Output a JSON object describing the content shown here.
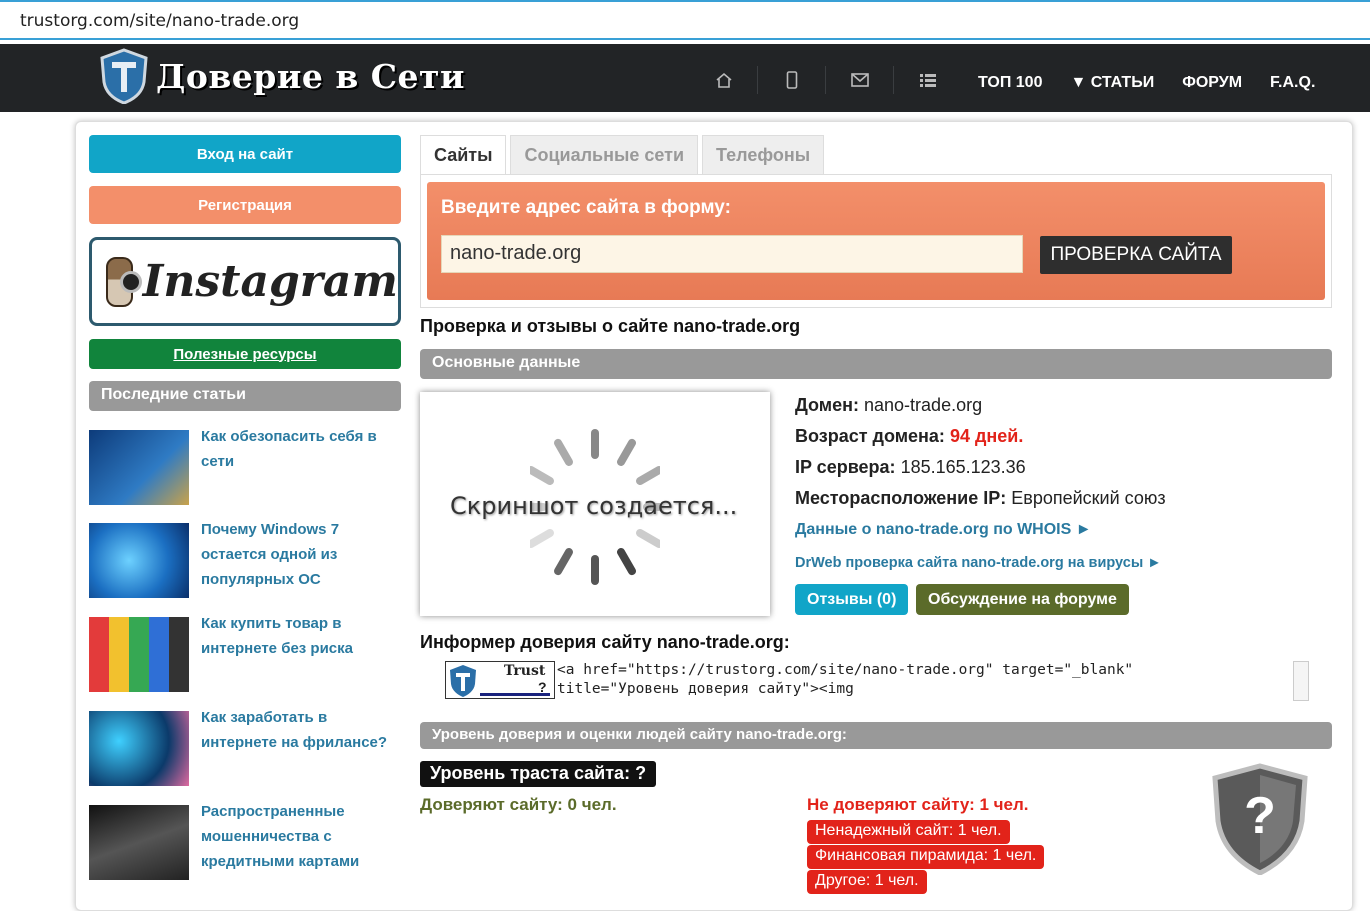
{
  "browser": {
    "url": "trustorg.com/site/nano-trade.org"
  },
  "site": {
    "logo_text": "Доверие в Сети"
  },
  "nav": {
    "icons": [
      "home-icon",
      "mobile-icon",
      "mail-icon",
      "list-icon"
    ],
    "links": [
      "ТОП 100",
      "▼ СТАТЬИ",
      "ФОРУМ",
      "F.A.Q."
    ]
  },
  "sidebar": {
    "login": "Вход на сайт",
    "register": "Регистрация",
    "instagram": "Instagram",
    "useful": "Полезные ресурсы",
    "recent_heading": "Последние статьи",
    "articles": [
      "Как обезопасить себя в сети",
      "Почему Windows 7 остается одной из популярных ОС",
      "Как купить товар в интернете без риска",
      "Как заработать в интернете на фрилансе?",
      "Распространенные мошенничества с кредитными картами"
    ]
  },
  "tabs": [
    "Сайты",
    "Социальные сети",
    "Телефоны"
  ],
  "form": {
    "prompt": "Введите адрес сайта в форму:",
    "value": "nano-trade.org",
    "button": "ПРОВЕРКА САЙТА"
  },
  "page_title": "Проверка и отзывы о сайте nano-trade.org",
  "basic": {
    "heading": "Основные данные",
    "screenshot_text": "Скриншот создается...",
    "domain_label": "Домен:",
    "domain_value": "nano-trade.org",
    "age_label": "Возраст домена:",
    "age_value": "94 дней.",
    "ip_label": "IP сервера:",
    "ip_value": "185.165.123.36",
    "loc_label": "Месторасположение IP:",
    "loc_value": "Европейский союз",
    "whois_link": "Данные о nano-trade.org по WHOIS ►",
    "drweb_link": "DrWeb проверка сайта nano-trade.org на вирусы ►",
    "reviews_button": "Отзывы (0)",
    "forum_button": "Обсуждение на форуме"
  },
  "informer": {
    "title": "Информер доверия сайту nano-trade.org:",
    "badge_text": "Trust",
    "badge_q": "?",
    "code": "<a href=\"https://trustorg.com/site/nano-trade.org\" target=\"_blank\"\ntitle=\"Уровень доверия сайту\"><img"
  },
  "trust": {
    "heading": "Уровень доверия и оценки людей сайту nano-trade.org:",
    "level": "Уровень траста сайта: ?",
    "trust_count": "Доверяют сайту: 0 чел.",
    "distrust_count": "Не доверяют сайту: 1 чел.",
    "reasons": [
      "Ненадежный сайт: 1 чел.",
      "Финансовая пирамида: 1 чел.",
      "Другое: 1 чел."
    ],
    "shield_symbol": "?"
  },
  "colors": {
    "accent_blue": "#11a5c8",
    "register_orange": "#f38f6a",
    "useful_green": "#11843c",
    "forum_olive": "#5b6b2a",
    "alert_red": "#e2231a"
  }
}
